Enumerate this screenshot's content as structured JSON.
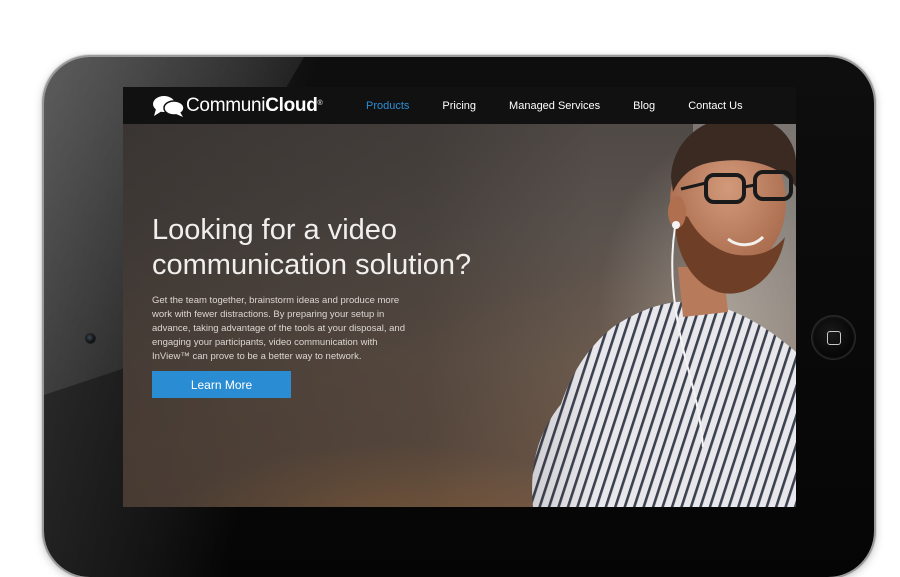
{
  "brand": {
    "name_light": "Communi",
    "name_bold": "Cloud",
    "registered_mark": "®"
  },
  "nav": {
    "items": [
      {
        "label": "Products",
        "active": true
      },
      {
        "label": "Pricing",
        "active": false
      },
      {
        "label": "Managed Services",
        "active": false
      },
      {
        "label": "Blog",
        "active": false
      },
      {
        "label": "Contact Us",
        "active": false
      }
    ]
  },
  "hero": {
    "headline_line1": "Looking for a video",
    "headline_line2": "communication solution?",
    "body": "Get the team together, brainstorm ideas and produce more work with fewer distractions. By preparing your setup in advance, taking advantage of the tools at your disposal, and engaging your participants, video communication with InView™ can prove to be a better way to network.",
    "cta_label": "Learn More"
  },
  "colors": {
    "accent": "#2a8dd4",
    "nav_active": "#2a8fd6",
    "navbar_bg": "#111111"
  },
  "icons": {
    "logo_mark": "chat-bubbles-icon",
    "home_button": "home-square-icon"
  }
}
